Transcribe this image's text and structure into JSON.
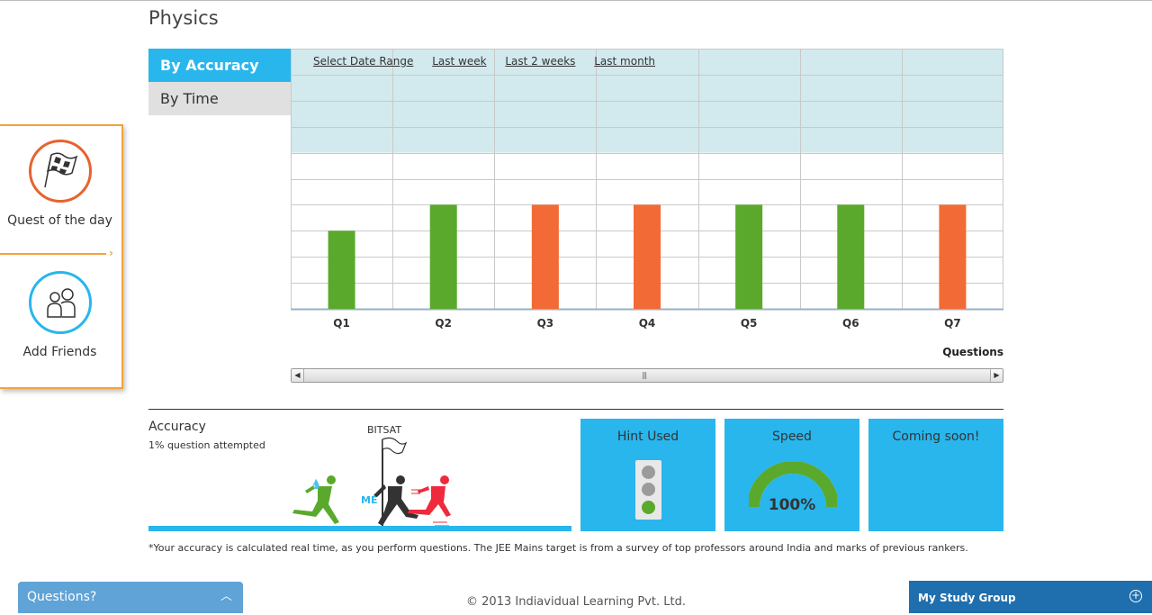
{
  "page": {
    "title": "Physics"
  },
  "left_panel": {
    "quest_label": "Quest of the day",
    "friends_label": "Add Friends"
  },
  "tabs": {
    "accuracy": "By Accuracy",
    "time": "By Time"
  },
  "date_filters": {
    "select": "Select Date Range",
    "last_week": "Last week",
    "last_2_weeks": "Last 2 weeks",
    "last_month": "Last month"
  },
  "chart_data": {
    "type": "bar",
    "categories": [
      "Q1",
      "Q2",
      "Q3",
      "Q4",
      "Q5",
      "Q6",
      "Q7"
    ],
    "values": [
      3,
      4,
      4,
      4,
      4,
      4,
      4
    ],
    "bar_colors": [
      "#5aa92c",
      "#5aa92c",
      "#f26a35",
      "#f26a35",
      "#5aa92c",
      "#5aa92c",
      "#f26a35"
    ],
    "xlabel": "Questions",
    "ylabel": "",
    "ylim": [
      0,
      10
    ],
    "grid": true,
    "band_color": "#d2eaed"
  },
  "accuracy": {
    "title": "Accuracy",
    "subtitle": "1% question attempted",
    "flag_label": "BITSAT",
    "me_label": "ME"
  },
  "cards": {
    "hint": {
      "title": "Hint Used"
    },
    "speed": {
      "title": "Speed",
      "value": "100%",
      "level": 1.0
    },
    "soon": {
      "title": "Coming soon!"
    }
  },
  "footnote": "*Your accuracy is calculated real time, as you perform questions. The JEE Mains target is from a survey of top professors around India and marks of previous rankers.",
  "copyright": "© 2013 Indiavidual Learning Pvt. Ltd.",
  "questions_bar": {
    "label": "Questions?"
  },
  "study_group": {
    "label": "My Study Group"
  },
  "colors": {
    "accent": "#29b6ec",
    "green": "#5aa92c",
    "orange": "#f26a35",
    "panel_border": "#f2a23b"
  }
}
